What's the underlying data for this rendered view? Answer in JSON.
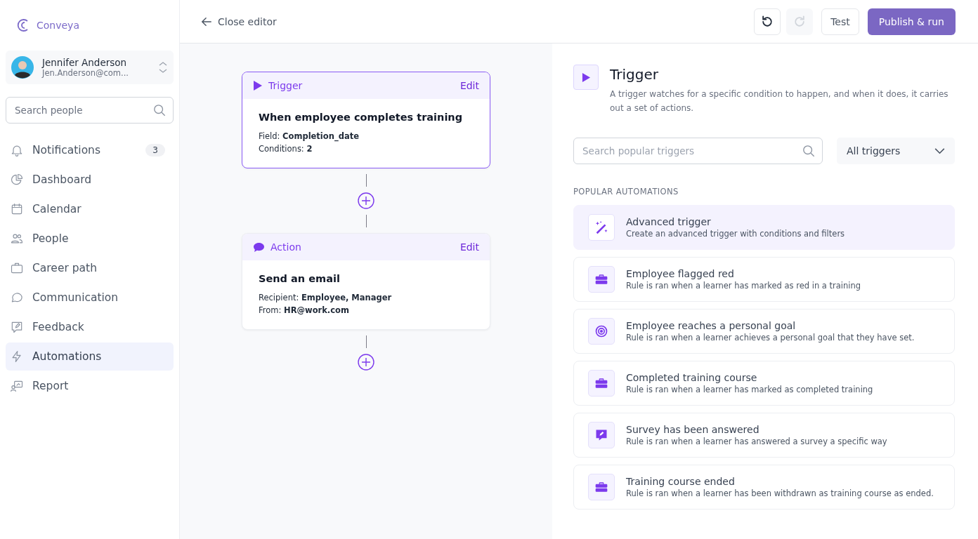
{
  "brand": {
    "name": "Conveya"
  },
  "user": {
    "name": "Jennifer Anderson",
    "email": "Jen.Anderson@com..."
  },
  "sidebar": {
    "search": {
      "placeholder": "Search people"
    },
    "items": [
      {
        "label": "Notifications",
        "badge": "3",
        "selected": false
      },
      {
        "label": "Dashboard",
        "selected": false
      },
      {
        "label": "Calendar",
        "selected": false
      },
      {
        "label": "People",
        "selected": false
      },
      {
        "label": "Career path",
        "selected": false
      },
      {
        "label": "Communication",
        "selected": false
      },
      {
        "label": "Feedback",
        "selected": false
      },
      {
        "label": "Automations",
        "selected": true
      },
      {
        "label": "Report",
        "selected": false
      }
    ]
  },
  "toolbar": {
    "close_label": "Close editor",
    "undo": {
      "disabled": false
    },
    "redo": {
      "disabled": true
    },
    "test_label": "Test",
    "publish_label": "Publish & run"
  },
  "flow": {
    "nodes": [
      {
        "kind": "trigger",
        "type_label": "Trigger",
        "edit_label": "Edit",
        "title": "When employee completes training",
        "selected": true,
        "lines": [
          "Field: **Completion_date**",
          "Conditions: **2**"
        ]
      },
      {
        "kind": "action",
        "type_label": "Action",
        "edit_label": "Edit",
        "title": "Send an email",
        "selected": false,
        "lines": [
          "Recipient: **Employee, Manager**",
          "From: **HR@work.com**"
        ]
      }
    ]
  },
  "panel": {
    "title": "Trigger",
    "description": "A trigger watches for a specific condition to happen, and when it does, it carries out a set of actions.",
    "search": {
      "placeholder": "Search popular triggers"
    },
    "filter": {
      "value": "All triggers"
    },
    "section_heading": "POPULAR AUTOMATIONS",
    "automations": [
      {
        "title": "Advanced trigger",
        "description": "Create an advanced trigger with conditions and filters",
        "selected": true
      },
      {
        "title": "Employee flagged red",
        "description": "Rule is ran when a learner has marked as red in a training",
        "selected": false
      },
      {
        "title": "Employee reaches a personal goal",
        "description": "Rule is ran when a learner achieves a personal goal that they have set.",
        "selected": false
      },
      {
        "title": "Completed training course",
        "description": "Rule is ran when a learner has marked as completed training",
        "selected": false
      },
      {
        "title": "Survey has been answered",
        "description": "Rule is ran when a learner has answered a survey a specific way",
        "selected": false
      },
      {
        "title": "Training course ended",
        "description": "Rule is ran when a learner has been withdrawn as training course as ended.",
        "selected": false
      }
    ]
  }
}
